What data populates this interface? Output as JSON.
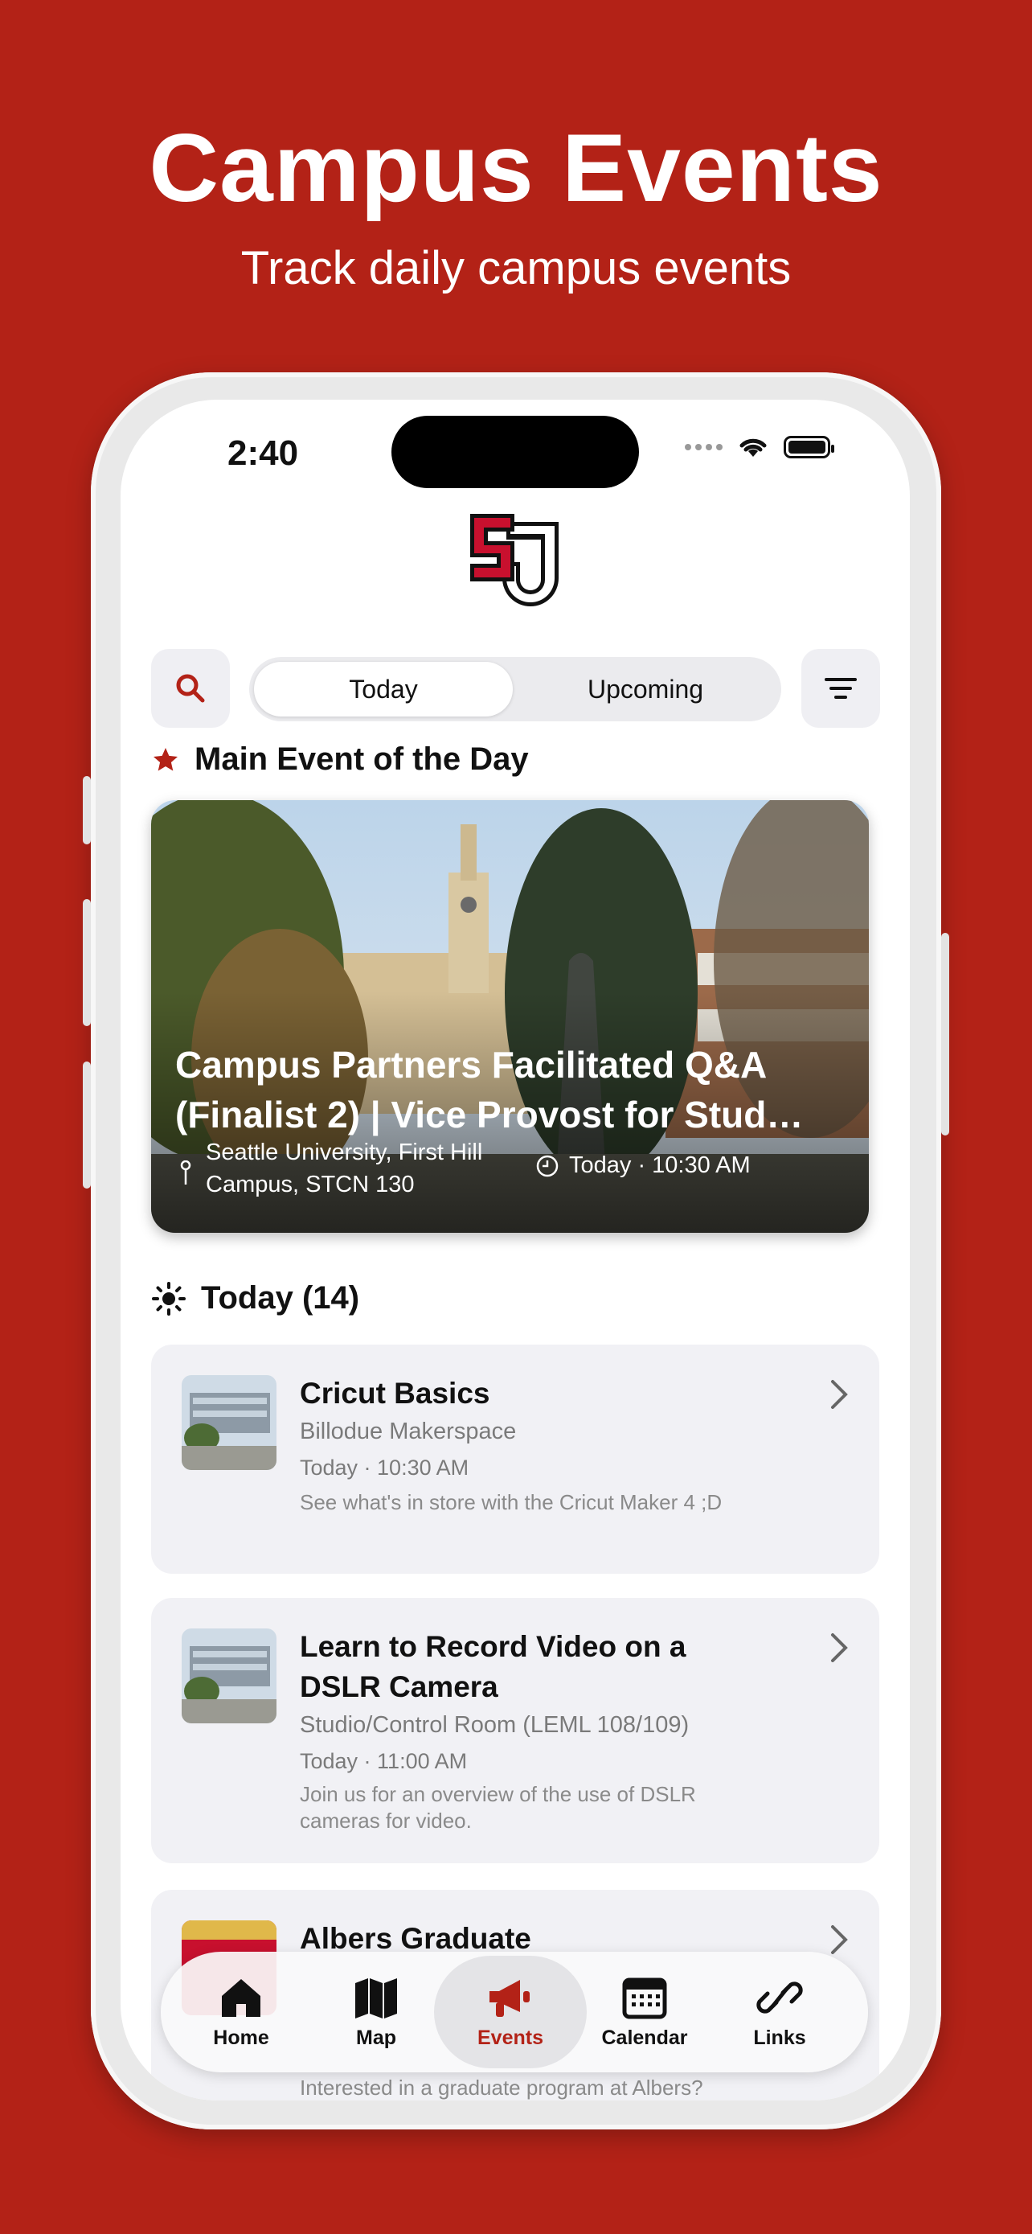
{
  "promo": {
    "title": "Campus Events",
    "subtitle": "Track daily campus events"
  },
  "status_bar": {
    "time": "2:40"
  },
  "segmented": {
    "options": [
      "Today",
      "Upcoming"
    ],
    "selected": "Today"
  },
  "main_event": {
    "section_title": "Main Event of the Day",
    "title_line1": "Campus Partners Facilitated Q&A",
    "title_line2": "(Finalist 2) | Vice Provost for Stud…",
    "location": "Seattle University, First Hill Campus, STCN 130",
    "time": "Today · 10:30 AM"
  },
  "today_section": {
    "title": "Today (14)"
  },
  "events": [
    {
      "title": "Cricut Basics",
      "location": "Billodue Makerspace",
      "time": "Today · 10:30 AM",
      "description": "See what's in store with the Cricut Maker 4 ;D"
    },
    {
      "title": "Learn to Record Video on a DSLR Camera",
      "location": "Studio/Control Room (LEML 108/109)",
      "time": "Today · 11:00 AM",
      "description": "Join us for an overview of the use of DSLR cameras for video."
    },
    {
      "title": "Albers Graduate",
      "description": "Interested in a graduate program at Albers?"
    }
  ],
  "tabs": {
    "home": "Home",
    "map": "Map",
    "events": "Events",
    "calendar": "Calendar",
    "links": "Links",
    "active": "Events"
  },
  "colors": {
    "brand_red": "#b32217",
    "card_bg": "#f1f1f5"
  }
}
